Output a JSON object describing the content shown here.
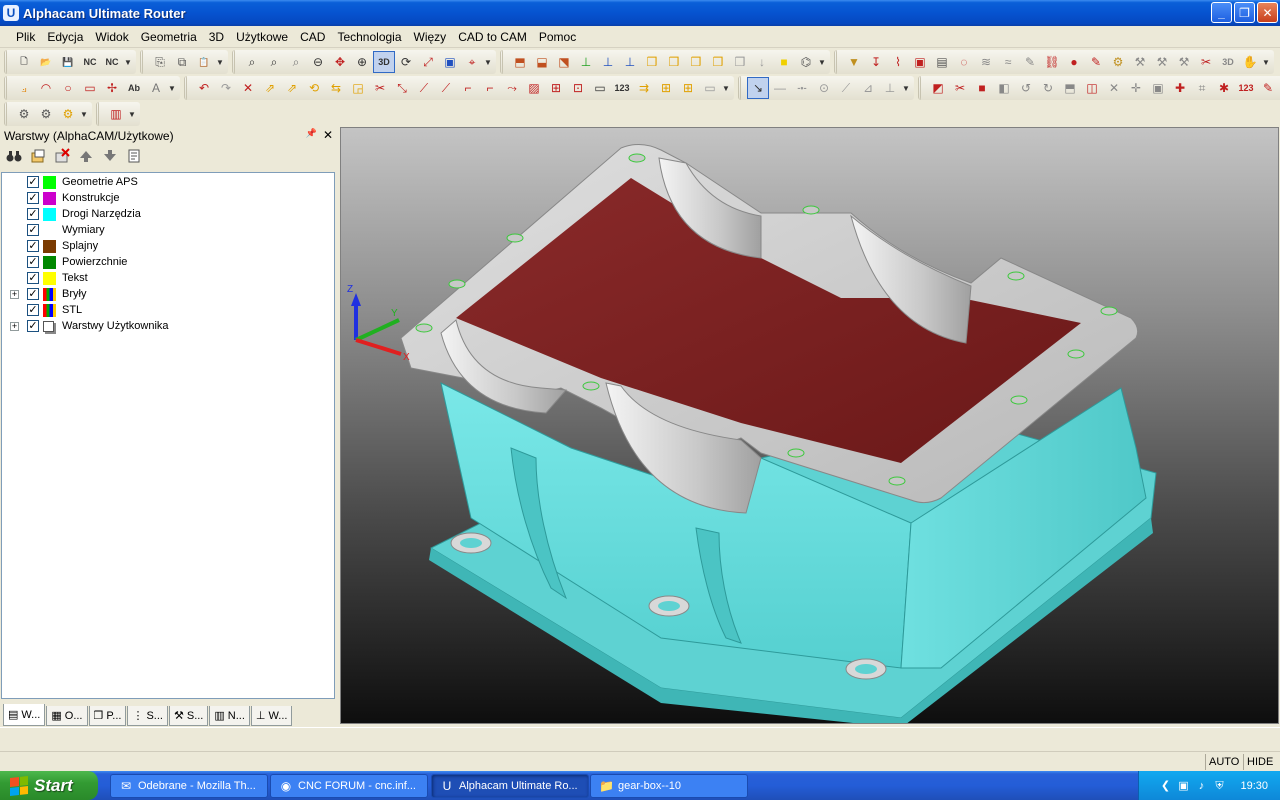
{
  "window": {
    "title": "Alphacam Ultimate Router"
  },
  "menu": [
    "Plik",
    "Edycja",
    "Widok",
    "Geometria",
    "3D",
    "Użytkowe",
    "CAD",
    "Technologia",
    "Więzy",
    "CAD to CAM",
    "Pomoc"
  ],
  "toolbars": {
    "icons_row1_a": [
      "new-file-icon",
      "open-folder-icon",
      "save-icon",
      "nc-icon",
      "nc-export-icon"
    ],
    "icons_row1_b": [
      "copy-icon",
      "layer-copy-icon",
      "paste-icon"
    ],
    "icons_row1_c": [
      "zoom-window-icon",
      "zoom-all-icon",
      "zoom-previous-icon",
      "zoom-out-icon",
      "pan-icon",
      "zoom-3d-icon",
      "view-3d-icon",
      "orbit-icon",
      "zoom-extend-icon",
      "render-icon",
      "locate-icon"
    ],
    "icons_row1_d": [
      "view-top-icon",
      "view-front-icon",
      "view-side-icon",
      "axis-icon",
      "axis-x-icon",
      "axis-y-icon",
      "cube-front-icon",
      "cube-back-icon",
      "cube-left-icon",
      "cube-right-icon",
      "cube-iso-icon",
      "arrow-down-icon",
      "yellow-box-icon",
      "work-plane-icon"
    ],
    "icons_row1_e": [
      "tool-icon",
      "drill-icon",
      "mill-icon",
      "pocket-icon",
      "sheet-icon",
      "contour-icon",
      "roughing-icon",
      "finish-icon",
      "edit-toolpath-icon",
      "link-icon",
      "stop-icon",
      "pen-icon",
      "machine-icon",
      "router-icon",
      "blade-icon",
      "spindle-icon",
      "engrave-icon",
      "3d-cut-icon",
      "hand-icon"
    ],
    "icons_row2_a": [
      "polyline-icon",
      "arc-icon",
      "circle-icon",
      "rectangle-icon",
      "point-icon",
      "text-icon",
      "text-style-icon"
    ],
    "icons_row2_b": [
      "undo-icon",
      "redo-icon",
      "delete-icon",
      "move-icon",
      "copy-geo-icon",
      "rotate-icon",
      "mirror-icon",
      "scale-icon",
      "trim-icon",
      "extend-icon",
      "break-icon",
      "join-icon",
      "fillet-icon",
      "chamfer-icon",
      "offset-icon",
      "hatch-icon",
      "explode-icon",
      "group-icon",
      "box-icon",
      "number-icon",
      "sort-icon",
      "array-icon",
      "nest-icon",
      "frame-icon"
    ],
    "icons_row2_c": [
      "snap-icon",
      "snap-line-icon",
      "snap-mid-icon",
      "snap-center-icon",
      "snap-tangent-icon",
      "snap-perp-icon",
      "snap-corner-icon"
    ],
    "icons_row2_d": [
      "solid-icon",
      "cut-solid-icon",
      "red-box-icon",
      "feature-icon",
      "sweep-icon",
      "revolve-icon",
      "extrude-icon",
      "shell-icon",
      "face-icon",
      "edge-icon",
      "surface-icon",
      "intersect-icon",
      "mesh-icon",
      "bug-icon",
      "dimension-icon",
      "pen-red-icon"
    ],
    "icons_row3_a": [
      "settings-icon",
      "config-icon",
      "gear-icon"
    ],
    "icons_row3_b": [
      "layer-icon"
    ]
  },
  "layers_panel": {
    "title": "Warstwy (AlphaCAM/Użytkowe)",
    "pin": "📌",
    "close": "✕",
    "items": [
      {
        "label": "Geometrie APS",
        "color": "#00FF00",
        "checked": true
      },
      {
        "label": "Konstrukcje",
        "color": "#CC00CC",
        "checked": true
      },
      {
        "label": "Drogi Narzędzia",
        "color": "#00FFFF",
        "checked": true
      },
      {
        "label": "Wymiary",
        "color": "",
        "checked": true
      },
      {
        "label": "Splajny",
        "color": "#7A3A00",
        "checked": true
      },
      {
        "label": "Powierzchnie",
        "color": "#008800",
        "checked": true
      },
      {
        "label": "Tekst",
        "color": "#FFFF00",
        "checked": true
      },
      {
        "label": "Bryły",
        "color": "multi",
        "checked": true,
        "expandable": true
      },
      {
        "label": "STL",
        "color": "multi",
        "checked": true
      },
      {
        "label": "Warstwy Użytkownika",
        "color": "userlayers",
        "checked": true,
        "expandable": true
      }
    ],
    "tabs": [
      "W...",
      "O...",
      "P...",
      "S...",
      "S...",
      "N...",
      "W..."
    ]
  },
  "viewport": {
    "axis_labels": {
      "z": "Z",
      "y": "Y",
      "x": "X"
    }
  },
  "status": {
    "auto": "AUTO",
    "hide": "HIDE"
  },
  "taskbar": {
    "start": "Start",
    "tasks": [
      {
        "label": "Odebrane - Mozilla Th...",
        "icon": "thunderbird-icon",
        "active": false
      },
      {
        "label": "CNC FORUM - cnc.inf...",
        "icon": "firefox-icon",
        "active": false
      },
      {
        "label": "Alphacam Ultimate Ro...",
        "icon": "alphacam-icon",
        "active": true
      },
      {
        "label": "gear-box--10",
        "icon": "folder-icon",
        "active": false
      }
    ],
    "clock": "19:30"
  }
}
